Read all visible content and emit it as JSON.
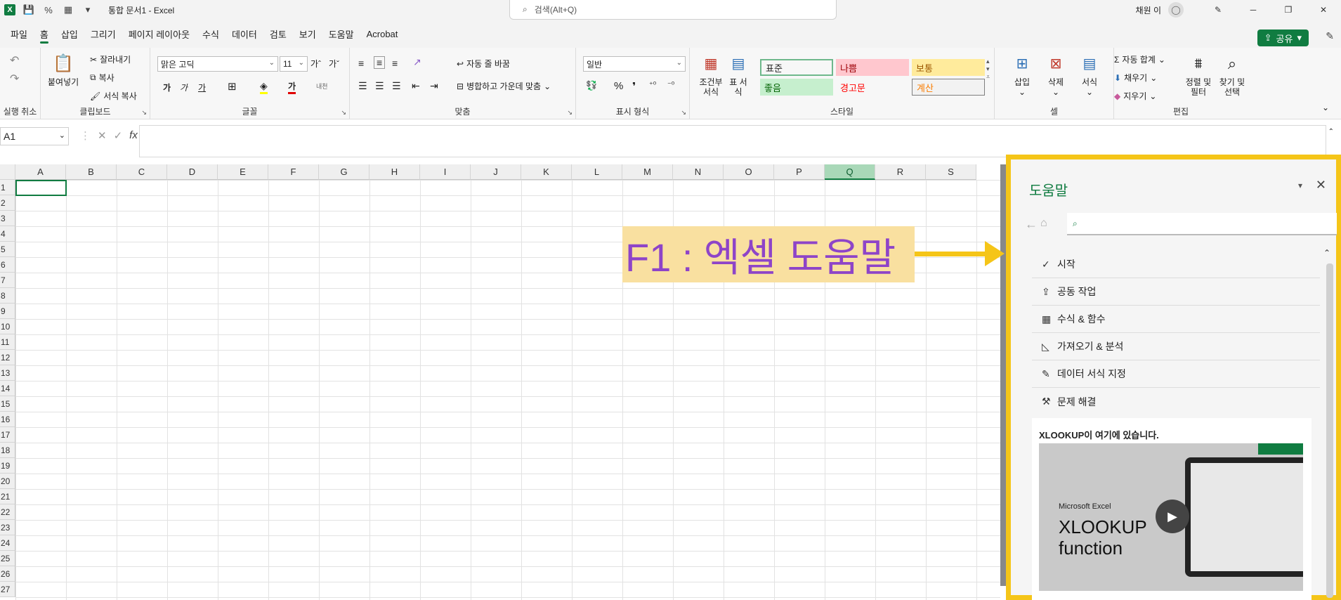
{
  "titlebar": {
    "doc_title": "통합 문서1  -  Excel",
    "search_placeholder": "검색(Alt+Q)",
    "user_name": "채원 이",
    "logo_letter": "X"
  },
  "menu": {
    "tabs": [
      "파일",
      "홈",
      "삽입",
      "그리기",
      "페이지 레이아웃",
      "수식",
      "데이터",
      "검토",
      "보기",
      "도움말",
      "Acrobat"
    ],
    "active_index": 1,
    "share_label": "공유"
  },
  "ribbon": {
    "undo_group": "실행 취소",
    "clipboard": {
      "label": "클립보드",
      "paste": "붙여넣기",
      "cut": "잘라내기",
      "copy": "복사",
      "format_painter": "서식 복사"
    },
    "font": {
      "label": "글꼴",
      "font_name": "맑은 고딕",
      "font_size": "11",
      "grow": "가ˆ",
      "shrink": "가ˇ",
      "bold": "가",
      "italic": "가",
      "underline": "가",
      "font_color_glyph": "가",
      "phonetic": "내천"
    },
    "alignment": {
      "label": "맞춤",
      "wrap": "자동 줄 바꿈",
      "merge": "병합하고 가운데 맞춤"
    },
    "number": {
      "label": "표시 형식",
      "format": "일반"
    },
    "styles": {
      "label": "스타일",
      "conditional": "조건부 서식",
      "table": "표 서식",
      "cells": [
        {
          "name": "표준",
          "bg": "#ffffff",
          "color": "#222222"
        },
        {
          "name": "나쁨",
          "bg": "#ffc7ce",
          "color": "#9c0006"
        },
        {
          "name": "보통",
          "bg": "#ffeb9c",
          "color": "#9c5700"
        },
        {
          "name": "좋음",
          "bg": "#c6efce",
          "color": "#006100"
        },
        {
          "name": "경고문",
          "bg": "#f7f7f7",
          "color": "#ff0000"
        },
        {
          "name": "계산",
          "bg": "#f2f2f2",
          "color": "#fa7d00"
        }
      ]
    },
    "cells": {
      "label": "셀",
      "insert": "삽입",
      "delete": "삭제",
      "format": "서식"
    },
    "editing": {
      "label": "편집",
      "autosum": "자동 합계",
      "fill": "채우기",
      "clear": "지우기",
      "sort": "정렬 및 필터",
      "find": "찾기 및 선택"
    }
  },
  "formula_bar": {
    "name_box": "A1",
    "fx": "fx"
  },
  "grid": {
    "columns": [
      "A",
      "B",
      "C",
      "D",
      "E",
      "F",
      "G",
      "H",
      "I",
      "J",
      "K",
      "L",
      "M",
      "N",
      "O",
      "P",
      "Q",
      "R",
      "S"
    ],
    "selected_column": "Q",
    "rows": [
      "1",
      "2",
      "3",
      "4",
      "5",
      "6",
      "7",
      "8",
      "9",
      "10",
      "11",
      "12",
      "13",
      "14",
      "15",
      "16",
      "17",
      "18",
      "19",
      "20",
      "21",
      "22",
      "23",
      "24",
      "25",
      "26",
      "27"
    ],
    "active_cell": "A1"
  },
  "annotation": {
    "text": "F1 : 엑셀 도움말",
    "bg": "#f9e0a0",
    "color": "#8e44c8",
    "arrow_color": "#f5c518"
  },
  "help_pane": {
    "title": "도움말",
    "items": [
      {
        "icon": "check-icon",
        "glyph": "✓",
        "label": "시작"
      },
      {
        "icon": "share-icon",
        "glyph": "⇪",
        "label": "공동 작업"
      },
      {
        "icon": "calculator-icon",
        "glyph": "▦",
        "label": "수식 & 함수"
      },
      {
        "icon": "chart-icon",
        "glyph": "◺",
        "label": "가져오기 & 분석"
      },
      {
        "icon": "format-icon",
        "glyph": "✎",
        "label": "데이터 서식 지정"
      },
      {
        "icon": "wrench-icon",
        "glyph": "⚒",
        "label": "문제 해결"
      }
    ],
    "card_title": "XLOOKUP이 여기에 있습니다.",
    "video_brand": "Microsoft Excel",
    "video_title": "XLOOKUP function"
  },
  "colors": {
    "accent": "#107c41",
    "highlight_border": "#f5c518"
  }
}
